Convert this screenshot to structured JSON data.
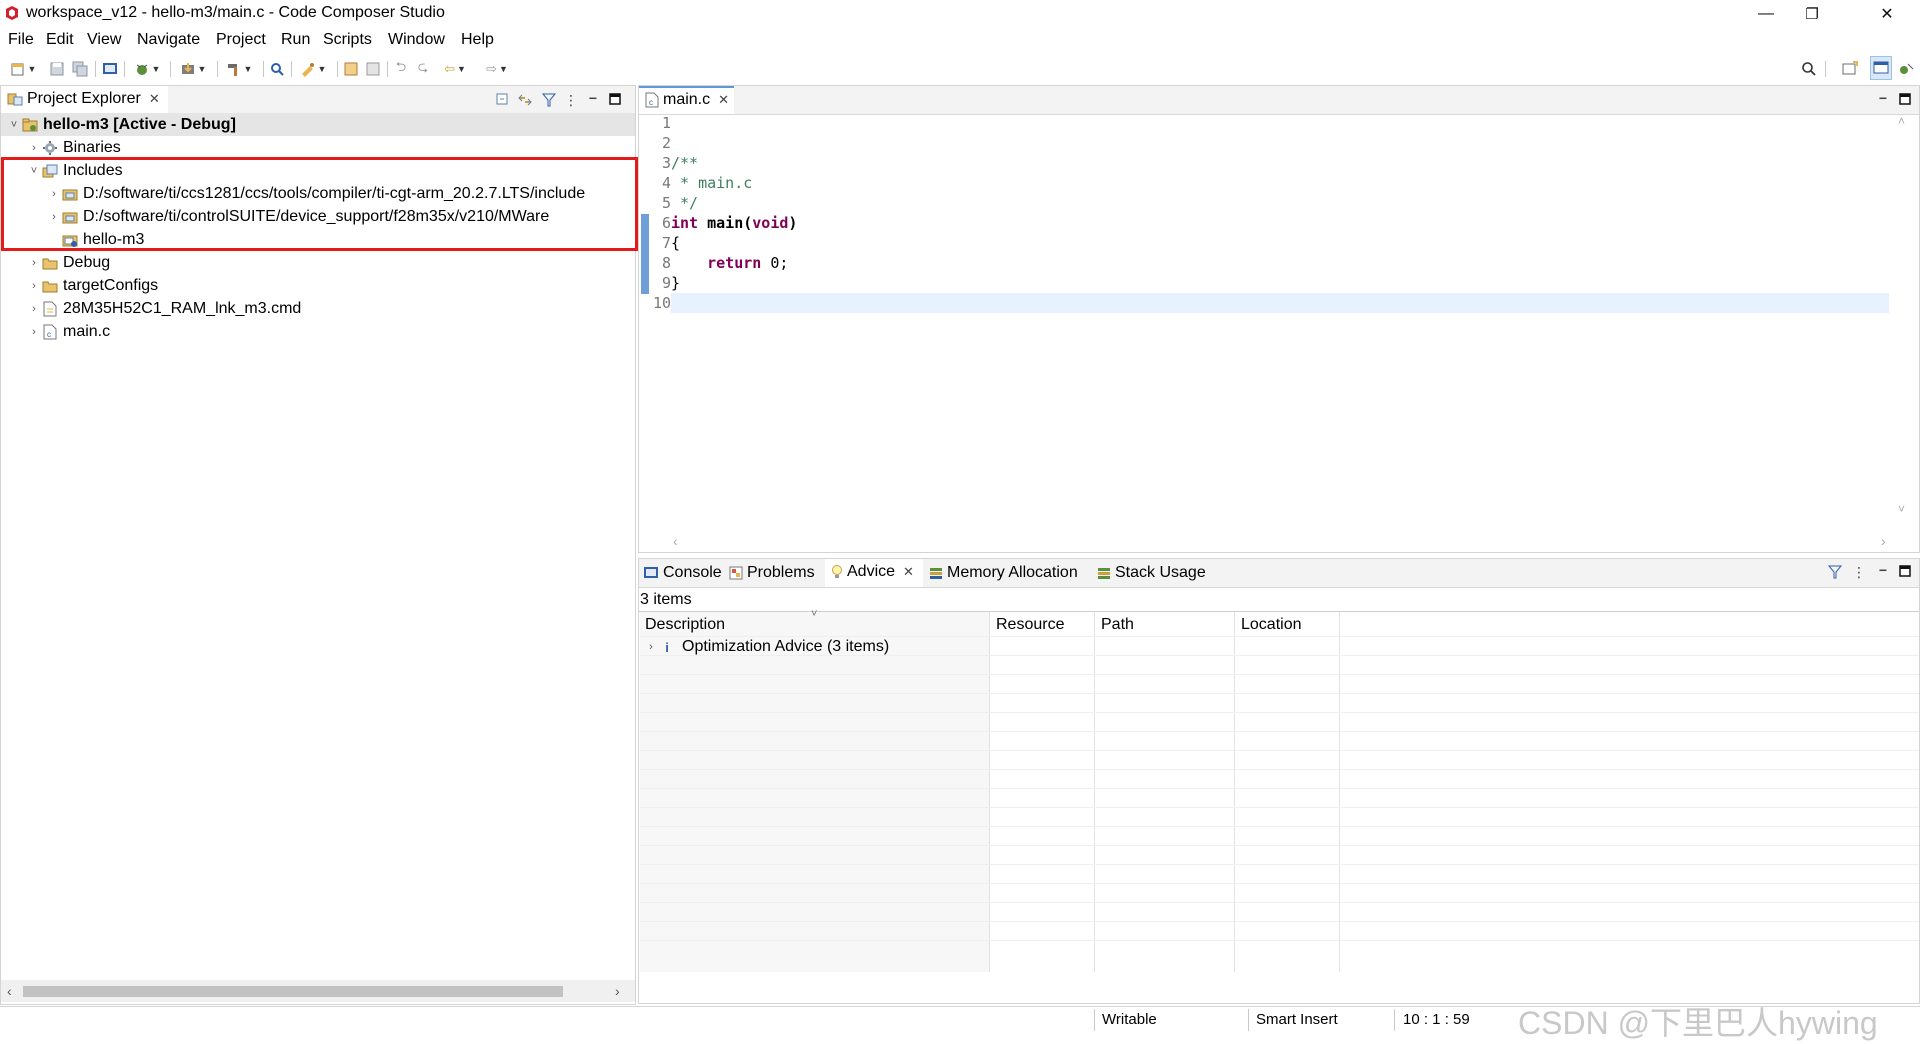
{
  "window": {
    "title": "workspace_v12 - hello-m3/main.c - Code Composer Studio",
    "controls": {
      "minimize": "—",
      "restore": "❐",
      "close": "✕"
    }
  },
  "menu": [
    "File",
    "Edit",
    "View",
    "Navigate",
    "Project",
    "Run",
    "Scripts",
    "Window",
    "Help"
  ],
  "project_explorer": {
    "tab_label": "Project Explorer",
    "tree": [
      {
        "label": "hello-m3  [Active - Debug]",
        "indent": 0,
        "expanded": true,
        "icon": "project-icon",
        "bold": true
      },
      {
        "label": "Binaries",
        "indent": 1,
        "expanded": false,
        "icon": "binaries-icon"
      },
      {
        "label": "Includes",
        "indent": 1,
        "expanded": true,
        "icon": "includes-icon"
      },
      {
        "label": "D:/software/ti/ccs1281/ccs/tools/compiler/ti-cgt-arm_20.2.7.LTS/include",
        "indent": 2,
        "expanded": false,
        "icon": "include-folder-icon"
      },
      {
        "label": "D:/software/ti/controlSUITE/device_support/f28m35x/v210/MWare",
        "indent": 2,
        "expanded": false,
        "icon": "include-folder-icon"
      },
      {
        "label": "hello-m3",
        "indent": 2,
        "expanded": null,
        "icon": "include-project-icon"
      },
      {
        "label": "Debug",
        "indent": 1,
        "expanded": false,
        "icon": "folder-icon"
      },
      {
        "label": "targetConfigs",
        "indent": 1,
        "expanded": false,
        "icon": "folder-icon"
      },
      {
        "label": "28M35H52C1_RAM_lnk_m3.cmd",
        "indent": 1,
        "expanded": false,
        "icon": "file-icon"
      },
      {
        "label": "main.c",
        "indent": 1,
        "expanded": false,
        "icon": "c-file-icon"
      }
    ]
  },
  "editor": {
    "tab_label": "main.c",
    "lines": [
      {
        "n": "1",
        "code": ""
      },
      {
        "n": "2",
        "code": ""
      },
      {
        "n": "3",
        "code": "/**",
        "style": "cm"
      },
      {
        "n": "4",
        "code": " * main.c",
        "style": "cm"
      },
      {
        "n": "5",
        "code": " */",
        "style": "cm"
      },
      {
        "n": "6",
        "code": "int main(void)",
        "style": "sig"
      },
      {
        "n": "7",
        "code": "{"
      },
      {
        "n": "8",
        "code": "    return 0;",
        "style": "ret"
      },
      {
        "n": "9",
        "code": "}"
      },
      {
        "n": "10",
        "code": ""
      }
    ],
    "current_line": 10
  },
  "bottom_panel": {
    "tabs": [
      "Console",
      "Problems",
      "Advice",
      "Memory Allocation",
      "Stack Usage"
    ],
    "active_tab": "Advice",
    "item_count": "3 items",
    "columns": [
      "Description",
      "Resource",
      "Path",
      "Location"
    ],
    "rows": [
      {
        "description": "Optimization Advice (3 items)",
        "resource": "",
        "path": "",
        "location": ""
      }
    ]
  },
  "status_bar": {
    "mode": "Writable",
    "insert": "Smart Insert",
    "position": "10 : 1 : 59"
  },
  "watermark": "CSDN @下里巴人hywing",
  "colors": {
    "highlight_box": "#e31b1b",
    "current_line": "#e8f2fe",
    "keyword": "#7f0055",
    "comment": "#3f7f5f",
    "tab_active_accent": "#5b9bd5"
  }
}
